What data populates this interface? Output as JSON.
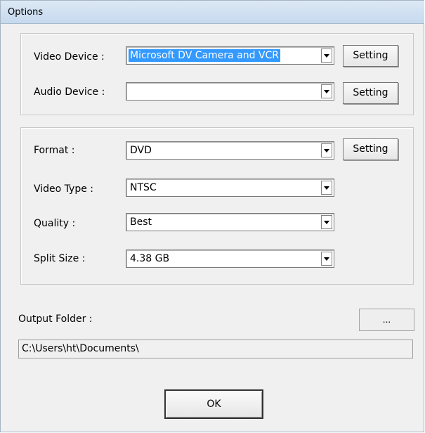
{
  "window": {
    "title": "Options"
  },
  "capture_group": {
    "video_device": {
      "label": "Video Device :",
      "value": "Microsoft DV Camera and VCR",
      "setting_label": "Setting"
    },
    "audio_device": {
      "label": "Audio Device :",
      "value": "",
      "setting_label": "Setting"
    }
  },
  "format_group": {
    "format": {
      "label": "Format :",
      "value": "DVD",
      "setting_label": "Setting"
    },
    "video_type": {
      "label": "Video Type :",
      "value": "NTSC"
    },
    "quality": {
      "label": "Quality :",
      "value": "Best"
    },
    "split_size": {
      "label": "Split Size :",
      "value": "4.38 GB"
    }
  },
  "output": {
    "label": "Output Folder :",
    "browse_label": "...",
    "path": "C:\\Users\\ht\\Documents\\"
  },
  "ok_label": "OK",
  "icons": {
    "dropdown": "chevron-down-icon"
  }
}
